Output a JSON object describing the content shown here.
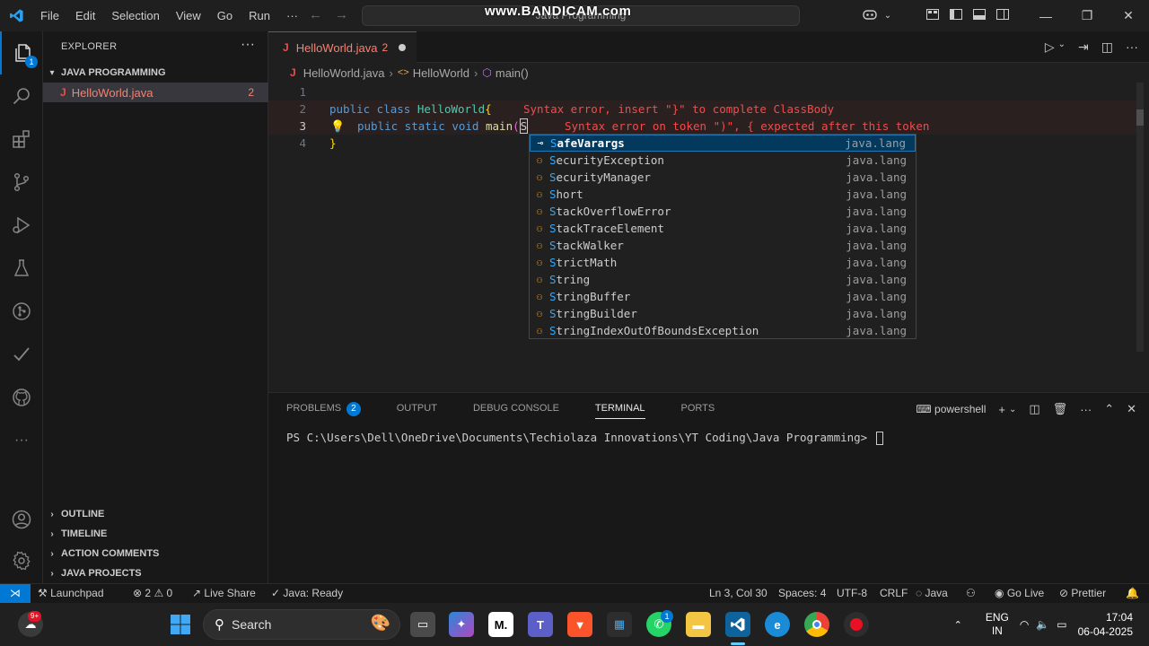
{
  "titlebar": {
    "menu": [
      "File",
      "Edit",
      "Selection",
      "View",
      "Go",
      "Run",
      "···"
    ],
    "command_center": "Java Programming",
    "watermark": "www.BANDICAM.com"
  },
  "activity": {
    "explorer_badge": "1"
  },
  "sidebar": {
    "title": "EXPLORER",
    "folder": "JAVA PROGRAMMING",
    "file": {
      "icon": "J",
      "name": "HelloWorld.java",
      "problems": "2"
    },
    "sections": [
      "OUTLINE",
      "TIMELINE",
      "ACTION COMMENTS",
      "JAVA PROJECTS"
    ]
  },
  "editor": {
    "tab": {
      "icon": "J",
      "name": "HelloWorld.java",
      "problems": "2"
    },
    "breadcrumb": {
      "file": "HelloWorld.java",
      "class": "HelloWorld",
      "method": "main()"
    },
    "lines": {
      "n1": "1",
      "n2": "2",
      "n3": "3",
      "n4": "4",
      "l2_kw": "public class ",
      "l2_cls": "HelloWorld",
      "l2_brace": "{",
      "l2_error": "Syntax error, insert \"}\" to complete ClassBody",
      "l3_kw": "public static void ",
      "l3_fn": "main",
      "l3_paren": "(",
      "l3_typed": "S",
      "l3_error": "Syntax error on token \")\", { expected after this token",
      "l4_brace": "}"
    }
  },
  "suggestions": [
    {
      "first": "S",
      "rest": "afeVarargs",
      "pkg": "java.lang",
      "icon": "annotation-icon"
    },
    {
      "first": "S",
      "rest": "ecurityException",
      "pkg": "java.lang",
      "icon": "class-icon"
    },
    {
      "first": "S",
      "rest": "ecurityManager",
      "pkg": "java.lang",
      "icon": "class-icon"
    },
    {
      "first": "S",
      "rest": "hort",
      "pkg": "java.lang",
      "icon": "class-icon"
    },
    {
      "first": "S",
      "rest": "tackOverflowError",
      "pkg": "java.lang",
      "icon": "class-icon"
    },
    {
      "first": "S",
      "rest": "tackTraceElement",
      "pkg": "java.lang",
      "icon": "class-icon"
    },
    {
      "first": "S",
      "rest": "tackWalker",
      "pkg": "java.lang",
      "icon": "class-icon"
    },
    {
      "first": "S",
      "rest": "trictMath",
      "pkg": "java.lang",
      "icon": "class-icon"
    },
    {
      "first": "S",
      "rest": "tring",
      "pkg": "java.lang",
      "icon": "class-icon"
    },
    {
      "first": "S",
      "rest": "tringBuffer",
      "pkg": "java.lang",
      "icon": "class-icon"
    },
    {
      "first": "S",
      "rest": "tringBuilder",
      "pkg": "java.lang",
      "icon": "class-icon"
    },
    {
      "first": "S",
      "rest": "tringIndexOutOfBoundsException",
      "pkg": "java.lang",
      "icon": "class-icon"
    }
  ],
  "panel": {
    "tabs": [
      "PROBLEMS",
      "OUTPUT",
      "DEBUG CONSOLE",
      "TERMINAL",
      "PORTS"
    ],
    "problems_badge": "2",
    "shell": "powershell",
    "prompt": "PS C:\\Users\\Dell\\OneDrive\\Documents\\Techiolaza Innovations\\YT Coding\\Java Programming> "
  },
  "statusbar": {
    "launchpad": "Launchpad",
    "errors": "2",
    "warnings": "0",
    "live_share": "Live Share",
    "java_status": "Java: Ready",
    "position": "Ln 3, Col 30",
    "spaces": "Spaces: 4",
    "encoding": "UTF-8",
    "eol": "CRLF",
    "language": "Java",
    "go_live": "Go Live",
    "prettier": "Prettier"
  },
  "taskbar": {
    "notif_badge": "9+",
    "search": "Search",
    "whatsapp_badge": "1",
    "lang_1": "ENG",
    "lang_2": "IN",
    "time": "17:04",
    "date": "06-04-2025"
  },
  "colors": {
    "accent": "#0078d4",
    "error": "#f14c4c",
    "keyword": "#569cd6",
    "class": "#4ec9b0"
  }
}
